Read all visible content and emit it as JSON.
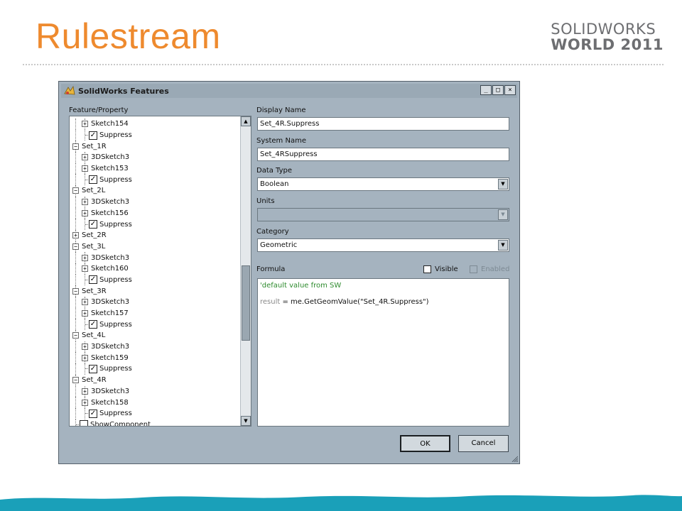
{
  "slide": {
    "title": "Rulestream",
    "brand_line1": "SOLIDWORKS",
    "brand_line2": "WORLD 2011",
    "accent_color": "#ee8a2e",
    "wave_color": "#1aa0b9"
  },
  "dialog": {
    "title": "SolidWorks Features",
    "app_icon": "solidworks-icon",
    "window_buttons": {
      "minimize": "_",
      "maximize": "□",
      "close": "×"
    },
    "tree": {
      "label": "Feature/Property",
      "items": [
        {
          "text": "Sketch154",
          "kind": "expand",
          "level": 1
        },
        {
          "text": "Suppress",
          "kind": "check",
          "level": 1
        },
        {
          "text": "Set_1R",
          "kind": "collapse",
          "level": 0
        },
        {
          "text": "3DSketch3",
          "kind": "expand",
          "level": 1
        },
        {
          "text": "Sketch153",
          "kind": "expand",
          "level": 1
        },
        {
          "text": "Suppress",
          "kind": "check",
          "level": 1
        },
        {
          "text": "Set_2L",
          "kind": "collapse",
          "level": 0
        },
        {
          "text": "3DSketch3",
          "kind": "expand",
          "level": 1
        },
        {
          "text": "Sketch156",
          "kind": "expand",
          "level": 1
        },
        {
          "text": "Suppress",
          "kind": "check",
          "level": 1
        },
        {
          "text": "Set_2R",
          "kind": "expand",
          "level": 0
        },
        {
          "text": "Set_3L",
          "kind": "collapse",
          "level": 0
        },
        {
          "text": "3DSketch3",
          "kind": "expand",
          "level": 1
        },
        {
          "text": "Sketch160",
          "kind": "expand",
          "level": 1
        },
        {
          "text": "Suppress",
          "kind": "check",
          "level": 1
        },
        {
          "text": "Set_3R",
          "kind": "collapse",
          "level": 0
        },
        {
          "text": "3DSketch3",
          "kind": "expand",
          "level": 1
        },
        {
          "text": "Sketch157",
          "kind": "expand",
          "level": 1
        },
        {
          "text": "Suppress",
          "kind": "check",
          "level": 1
        },
        {
          "text": "Set_4L",
          "kind": "collapse",
          "level": 0
        },
        {
          "text": "3DSketch3",
          "kind": "expand",
          "level": 1
        },
        {
          "text": "Sketch159",
          "kind": "expand",
          "level": 1
        },
        {
          "text": "Suppress",
          "kind": "check",
          "level": 1
        },
        {
          "text": "Set_4R",
          "kind": "collapse",
          "level": 0
        },
        {
          "text": "3DSketch3",
          "kind": "expand",
          "level": 1
        },
        {
          "text": "Sketch158",
          "kind": "expand",
          "level": 1
        },
        {
          "text": "Suppress",
          "kind": "check",
          "level": 1
        },
        {
          "text": "ShowComponent",
          "kind": "uncheck",
          "level": 0
        }
      ]
    },
    "display_name": {
      "label": "Display Name",
      "value": "Set_4R.Suppress"
    },
    "system_name": {
      "label": "System Name",
      "value": "Set_4RSuppress"
    },
    "data_type": {
      "label": "Data Type",
      "value": "Boolean"
    },
    "units": {
      "label": "Units",
      "value": ""
    },
    "category": {
      "label": "Category",
      "value": "Geometric"
    },
    "formula": {
      "label": "Formula",
      "visible_label": "Visible",
      "enabled_label": "Enabled",
      "comment": "'default value from SW",
      "code_keyword": "result",
      "code_rest": " = me.GetGeomValue(\"Set_4R.Suppress\")"
    },
    "ok_label": "OK",
    "cancel_label": "Cancel"
  }
}
